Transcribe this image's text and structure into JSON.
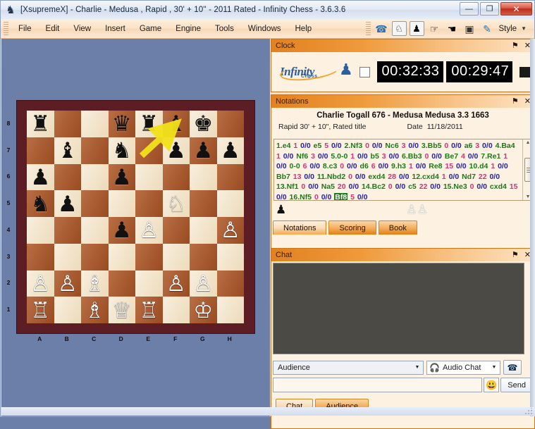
{
  "window": {
    "title": "[XsupremeX] - Charlie - Medusa , Rapid , 30' + 10'' - 2011 Rated - Infinity Chess - 3.6.3.6",
    "app_icon": "chess-pawn-icon",
    "minimize_label": "—",
    "maximize_label": "❐",
    "close_label": "✕"
  },
  "menubar": {
    "items": [
      {
        "label": "File"
      },
      {
        "label": "Edit"
      },
      {
        "label": "View"
      },
      {
        "label": "Insert"
      },
      {
        "label": "Game"
      },
      {
        "label": "Engine"
      },
      {
        "label": "Tools"
      },
      {
        "label": "Windows"
      },
      {
        "label": "Help"
      }
    ],
    "toolbar_icons": [
      {
        "name": "telephone-icon",
        "glyph": "☎"
      },
      {
        "name": "white-knight-icon",
        "glyph": "♘"
      },
      {
        "name": "black-pawn-icon",
        "glyph": "♟"
      },
      {
        "name": "hand-offer-draw-icon",
        "glyph": "☞"
      },
      {
        "name": "hand-resign-icon",
        "glyph": "☚"
      },
      {
        "name": "board-icon",
        "glyph": "▣"
      },
      {
        "name": "edit-board-icon",
        "glyph": "✎"
      }
    ],
    "style_label": "Style",
    "style_arrow": "▼"
  },
  "clock": {
    "panel_title": "Clock",
    "pin_icon": "⚑",
    "close_icon": "✕",
    "logo_main": "Infinity",
    "logo_sub": "Chess",
    "white_time": "00:32:33",
    "black_time": "00:29:47",
    "white_turn_indicator": "empty",
    "black_turn_indicator": "filled"
  },
  "notations": {
    "panel_title": "Notations",
    "pin_icon": "⚑",
    "close_icon": "✕",
    "players": "Charlie Togall 676 - Medusa Medusa 3.3 1663",
    "event": "Rapid 30' + 10\", Rated  title",
    "date_label": "Date",
    "date_value": "11/18/2011",
    "moves": [
      {
        "no": "1.",
        "move": "e4",
        "eval": "1",
        "zz": "0/0"
      },
      {
        "no": "",
        "move": "e5",
        "eval": "5",
        "zz": "0/0"
      },
      {
        "no": "2.",
        "move": "Nf3",
        "eval": "0",
        "zz": "0/0"
      },
      {
        "no": "",
        "move": "Nc6",
        "eval": "3",
        "zz": "0/0"
      },
      {
        "no": "3.",
        "move": "Bb5",
        "eval": "0",
        "zz": "0/0"
      },
      {
        "no": "",
        "move": "a6",
        "eval": "3",
        "zz": "0/0"
      },
      {
        "no": "4.",
        "move": "Ba4",
        "eval": "1",
        "zz": "0/0"
      },
      {
        "no": "",
        "move": "Nf6",
        "eval": "3",
        "zz": "0/0"
      },
      {
        "no": "5.",
        "move": "0-0",
        "eval": "1",
        "zz": "0/0"
      },
      {
        "no": "",
        "move": "b5",
        "eval": "3",
        "zz": "0/0"
      },
      {
        "no": "6.",
        "move": "Bb3",
        "eval": "0",
        "zz": "0/0"
      },
      {
        "no": "",
        "move": "Be7",
        "eval": "4",
        "zz": "0/0"
      },
      {
        "no": "7.",
        "move": "Re1",
        "eval": "1",
        "zz": "0/0"
      },
      {
        "no": "",
        "move": "0-0",
        "eval": "6",
        "zz": "0/0"
      },
      {
        "no": "8.",
        "move": "c3",
        "eval": "0",
        "zz": "0/0"
      },
      {
        "no": "",
        "move": "d6",
        "eval": "6",
        "zz": "0/0"
      },
      {
        "no": "9.",
        "move": "h3",
        "eval": "1",
        "zz": "0/0"
      },
      {
        "no": "",
        "move": "Re8",
        "eval": "15",
        "zz": "0/0"
      },
      {
        "no": "10.",
        "move": "d4",
        "eval": "1",
        "zz": "0/0"
      },
      {
        "no": "",
        "move": "Bb7",
        "eval": "13",
        "zz": "0/0"
      },
      {
        "no": "11.",
        "move": "Nbd2",
        "eval": "0",
        "zz": "0/0"
      },
      {
        "no": "",
        "move": "exd4",
        "eval": "28",
        "zz": "0/0"
      },
      {
        "no": "12.",
        "move": "cxd4",
        "eval": "1",
        "zz": "0/0"
      },
      {
        "no": "",
        "move": "Nd7",
        "eval": "22",
        "zz": "0/0"
      },
      {
        "no": "13.",
        "move": "Nf1",
        "eval": "0",
        "zz": "0/0"
      },
      {
        "no": "",
        "move": "Na5",
        "eval": "20",
        "zz": "0/0"
      },
      {
        "no": "14.",
        "move": "Bc2",
        "eval": "0",
        "zz": "0/0"
      },
      {
        "no": "",
        "move": "c5",
        "eval": "22",
        "zz": "0/0"
      },
      {
        "no": "15.",
        "move": "Ne3",
        "eval": "0",
        "zz": "0/0"
      },
      {
        "no": "",
        "move": "cxd4",
        "eval": "15",
        "zz": "0/0"
      },
      {
        "no": "16.",
        "move": "Nf5",
        "eval": "0",
        "zz": "0/0"
      },
      {
        "no": "",
        "move": "Bf8",
        "eval": "5",
        "zz": "0/0",
        "selected": true
      }
    ],
    "captured": [
      {
        "color": "b",
        "glyph": "♟",
        "name": "captured-black-pawn"
      },
      {
        "color": "w",
        "glyph": "♙",
        "name": "captured-white-pawn"
      },
      {
        "color": "w",
        "glyph": "♙",
        "name": "captured-white-pawn"
      }
    ],
    "tabs": [
      {
        "label": "Notations",
        "active": true
      },
      {
        "label": "Scoring",
        "active": false
      },
      {
        "label": "Book",
        "active": false
      }
    ],
    "scroll_up": "▲",
    "scroll_down": "▼"
  },
  "chat": {
    "panel_title": "Chat",
    "pin_icon": "⚑",
    "close_icon": "✕",
    "log_text": "",
    "audience_selected": "Audience",
    "audience_arrow": "▼",
    "audio_chat_label": "Audio Chat",
    "audio_arrow": "▼",
    "headset_icon": "Ἲ7",
    "call_icon": "☎",
    "input_value": "",
    "input_placeholder": "",
    "emoji_icon": "☺",
    "send_label": "Send",
    "tabs": [
      {
        "label": "Chat",
        "active": true
      },
      {
        "label": "Audience",
        "active": false
      }
    ]
  },
  "board": {
    "files": [
      "A",
      "B",
      "C",
      "D",
      "E",
      "F",
      "G",
      "H"
    ],
    "ranks": [
      "8",
      "7",
      "6",
      "5",
      "4",
      "3",
      "2",
      "1"
    ],
    "light_color": "#f2e2c4",
    "dark_color": "#b05a2a",
    "border_color": "#5d1d24",
    "arrow_color": "#f2e21a",
    "last_move_from": "e7",
    "last_move_to": "f8",
    "rows": [
      [
        "r",
        "",
        "",
        "q",
        "r",
        "b",
        "k",
        ""
      ],
      [
        "",
        "b",
        "",
        "n",
        "",
        "p",
        "p",
        "p"
      ],
      [
        "p",
        "",
        "",
        "p",
        "",
        "",
        "",
        ""
      ],
      [
        "n",
        "p",
        "",
        "",
        "",
        "N",
        "",
        ""
      ],
      [
        "",
        "",
        "",
        "p",
        "P",
        "",
        "",
        ""
      ],
      [
        "",
        "",
        "",
        "",
        "",
        "",
        "",
        ""
      ],
      [
        "P",
        "P",
        "B",
        "",
        "",
        "P",
        "P",
        ""
      ],
      [
        "R",
        "",
        "B",
        "Q",
        "R",
        "",
        "K",
        ""
      ]
    ],
    "extra": {
      "h4_white_pawn": "h4"
    },
    "glyphs": {
      "K": "♔",
      "Q": "♕",
      "R": "♖",
      "B": "♗",
      "N": "♘",
      "P": "♙",
      "k": "♚",
      "q": "♛",
      "r": "♜",
      "b": "♝",
      "n": "♞",
      "p": "♟"
    }
  }
}
